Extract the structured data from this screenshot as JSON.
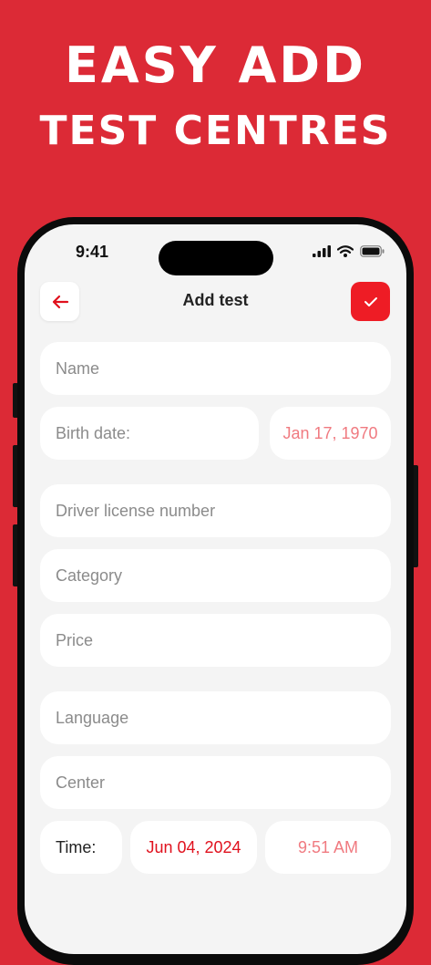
{
  "headline": {
    "line1": "EASY ADD",
    "line2": "TEST CENTRES"
  },
  "status_bar": {
    "time": "9:41"
  },
  "screen": {
    "title": "Add test"
  },
  "form": {
    "name_placeholder": "Name",
    "birth_date_label": "Birth date:",
    "birth_date_value": "Jan 17, 1970",
    "license_placeholder": "Driver license number",
    "category_placeholder": "Category",
    "price_placeholder": "Price",
    "language_placeholder": "Language",
    "center_placeholder": "Center",
    "time_label": "Time:",
    "date_value": "Jun 04, 2024",
    "time_value": "9:51 AM"
  },
  "colors": {
    "background": "#dc2a36",
    "accent": "#ee1c25",
    "date_pink": "#f07a80"
  },
  "icons": [
    "back-arrow-icon",
    "checkmark-icon",
    "signal-icon",
    "wifi-icon",
    "battery-icon"
  ]
}
